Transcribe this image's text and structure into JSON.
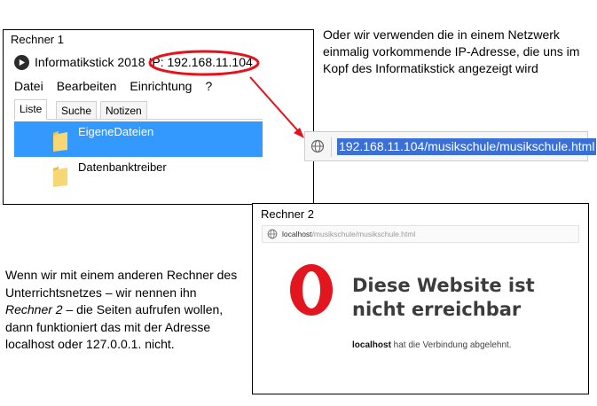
{
  "rechner1": {
    "label": "Rechner 1",
    "app_title": "Informatikstick  2018",
    "ip_label": "IP: 192.168.11.104",
    "menu": [
      "Datei",
      "Bearbeiten",
      "Einrichtung",
      "?"
    ],
    "tabs": [
      "Liste",
      "Suche",
      "Notizen"
    ],
    "active_tab": "Liste",
    "items": [
      {
        "label": "EigeneDateien",
        "selected": true
      },
      {
        "label": "Datenbanktreiber",
        "selected": false
      }
    ],
    "icons": {
      "app": "play-icon",
      "item": "folder-icon"
    },
    "highlight_color": "#e8111b",
    "selection_color": "#3399ff"
  },
  "address_bar": {
    "url": "192.168.11.104/musikschule/musikschule.html",
    "icon": "globe-icon"
  },
  "note_top": "Oder wir verwenden die in einem Netzwerk einmalig vorkommende IP-Adresse, die uns im Kopf des Informatikstick angezeigt wird",
  "note_bottom": {
    "part1": "Wenn wir mit einem anderen Rechner des Unterrichtsnetzes – wir nennen ihn ",
    "emphasis": "Rechner 2",
    "part2": " – die Seiten aufrufen wollen, dann funktioniert das mit der Adresse localhost oder 127.0.0.1. nicht."
  },
  "rechner2": {
    "label": "Rechner 2",
    "url_host": "localhost",
    "url_path": "/musikschule/musikschule.html",
    "error_title": "Diese Website ist nicht erreichbar",
    "error_host": "localhost",
    "error_text": " hat die Verbindung abgelehnt.",
    "icons": {
      "address": "globe-icon",
      "browser": "opera-logo"
    },
    "opera_color": "#e3151f"
  }
}
